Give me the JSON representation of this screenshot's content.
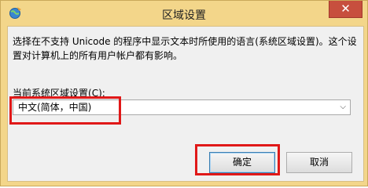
{
  "window": {
    "title": "区域设置",
    "close_glyph": "✕"
  },
  "content": {
    "description": "选择在不支持 Unicode 的程序中显示文本时所使用的语言(系统区域设置)。这个设置对计算机上的所有用户帐户都有影响。",
    "locale_label_prefix": "当前系统区域设置(",
    "locale_label_hotkey": "C",
    "locale_label_suffix": "):",
    "locale_selected": "中文(简体，中国)"
  },
  "buttons": {
    "ok": "确定",
    "cancel": "取消"
  },
  "colors": {
    "titlebar": "#f3d68a",
    "highlight": "#e01818",
    "close": "#c74f3e"
  },
  "icons": {
    "title": "globe-icon",
    "dropdown": "chevron-down-icon"
  }
}
